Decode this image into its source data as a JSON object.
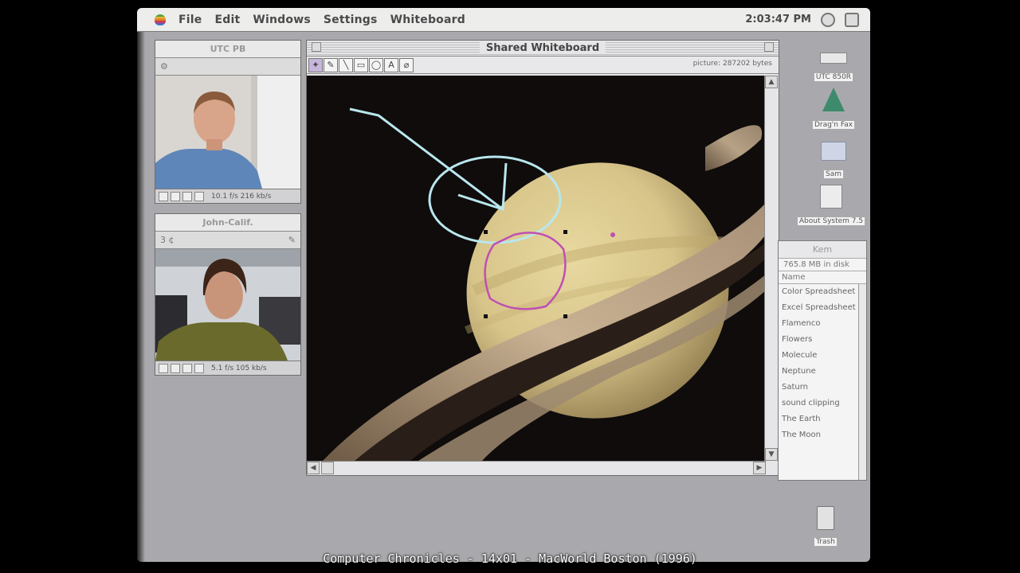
{
  "menubar": {
    "items": [
      "File",
      "Edit",
      "Windows",
      "Settings",
      "Whiteboard"
    ],
    "clock": "2:03:47 PM"
  },
  "video_windows": [
    {
      "title": "UTC PB",
      "status": "10.1 f/s  216 kb/s"
    },
    {
      "title": "John-Calif.",
      "field": "3 ¢",
      "status": "5.1 f/s  105 kb/s"
    }
  ],
  "whiteboard": {
    "title": "Shared Whiteboard",
    "picture_info": "picture: 287202 bytes",
    "tools": [
      "pen",
      "pencil",
      "line",
      "rect",
      "oval",
      "text",
      "eraser"
    ]
  },
  "desktop_icons": [
    {
      "name": "drive-icon",
      "label": "UTC 850R"
    },
    {
      "name": "tree-icon",
      "label": "Drag'n Fax"
    },
    {
      "name": "folder-icon",
      "label": "Sam"
    },
    {
      "name": "document-icon",
      "label": "About System 7.5"
    },
    {
      "name": "trash-icon",
      "label": "Trash"
    }
  ],
  "finder": {
    "title": "Kem",
    "info": "765.8 MB in disk",
    "header": "Name",
    "items": [
      "Color Spreadsheet",
      "Excel Spreadsheet",
      "Flamenco",
      "Flowers",
      "Molecule",
      "Neptune",
      "Saturn",
      "sound clipping",
      "The Earth",
      "The Moon"
    ]
  },
  "subtitle": "Computer Chronicles - 14x01 - MacWorld Boston (1996)",
  "colors": {
    "desktop": "#a9a9ad",
    "annotation_cyan": "#b9e6ee",
    "annotation_magenta": "#c04fb4"
  }
}
